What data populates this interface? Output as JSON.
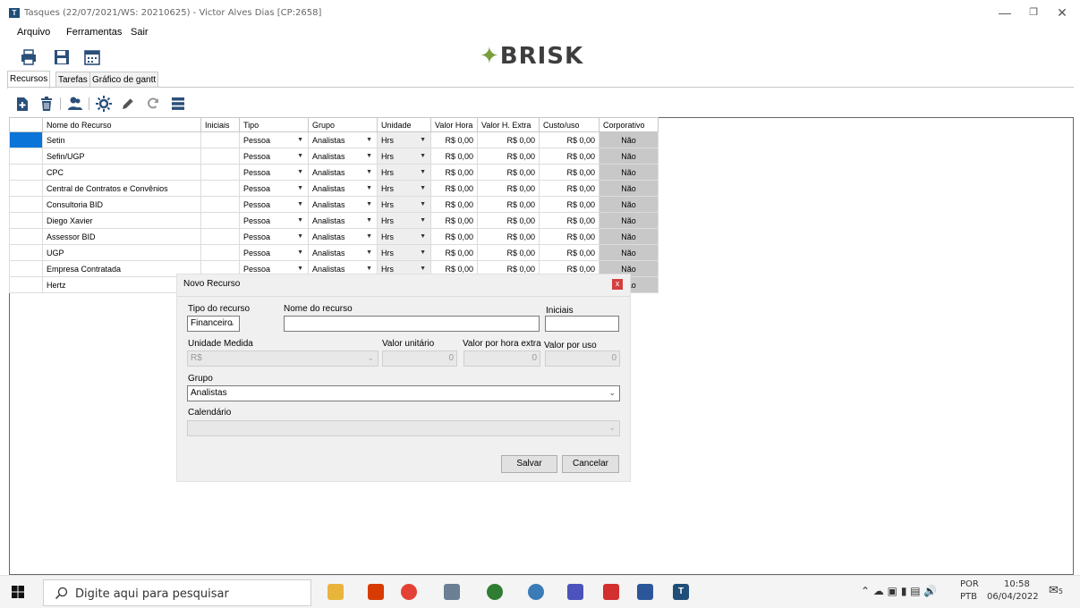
{
  "window": {
    "title": "Tasques (22/07/2021/WS: 20210625) - Victor Alves Dias [CP:2658]",
    "app_icon": "T"
  },
  "menu": [
    "Arquivo",
    "Ferramentas",
    "Sair"
  ],
  "logo": {
    "text": "BRISK",
    "mark": "✦"
  },
  "tabs": [
    {
      "label": "Recursos",
      "active": true
    },
    {
      "label": "Tarefas",
      "active": false
    },
    {
      "label": "Gráfico de gantt",
      "active": false
    }
  ],
  "grid": {
    "columns": [
      "Nome do Recurso",
      "Iniciais",
      "Tipo",
      "Grupo",
      "Unidade",
      "Valor Hora",
      "Valor H. Extra",
      "Custo/uso",
      "Corporativo"
    ],
    "rows": [
      {
        "nome": "Setin",
        "iniciais": "",
        "tipo": "Pessoa",
        "grupo": "Analistas",
        "unidade": "Hrs",
        "valor_hora": "R$ 0,00",
        "valor_extra": "R$ 0,00",
        "custo": "R$ 0,00",
        "corporativo": "Não"
      },
      {
        "nome": "Sefin/UGP",
        "iniciais": "",
        "tipo": "Pessoa",
        "grupo": "Analistas",
        "unidade": "Hrs",
        "valor_hora": "R$ 0,00",
        "valor_extra": "R$ 0,00",
        "custo": "R$ 0,00",
        "corporativo": "Não"
      },
      {
        "nome": "CPC",
        "iniciais": "",
        "tipo": "Pessoa",
        "grupo": "Analistas",
        "unidade": "Hrs",
        "valor_hora": "R$ 0,00",
        "valor_extra": "R$ 0,00",
        "custo": "R$ 0,00",
        "corporativo": "Não"
      },
      {
        "nome": "Central de Contratos e Convênios",
        "iniciais": "",
        "tipo": "Pessoa",
        "grupo": "Analistas",
        "unidade": "Hrs",
        "valor_hora": "R$ 0,00",
        "valor_extra": "R$ 0,00",
        "custo": "R$ 0,00",
        "corporativo": "Não"
      },
      {
        "nome": "Consultoria BID",
        "iniciais": "",
        "tipo": "Pessoa",
        "grupo": "Analistas",
        "unidade": "Hrs",
        "valor_hora": "R$ 0,00",
        "valor_extra": "R$ 0,00",
        "custo": "R$ 0,00",
        "corporativo": "Não"
      },
      {
        "nome": "Diego Xavier",
        "iniciais": "",
        "tipo": "Pessoa",
        "grupo": "Analistas",
        "unidade": "Hrs",
        "valor_hora": "R$ 0,00",
        "valor_extra": "R$ 0,00",
        "custo": "R$ 0,00",
        "corporativo": "Não"
      },
      {
        "nome": "Assessor BID",
        "iniciais": "",
        "tipo": "Pessoa",
        "grupo": "Analistas",
        "unidade": "Hrs",
        "valor_hora": "R$ 0,00",
        "valor_extra": "R$ 0,00",
        "custo": "R$ 0,00",
        "corporativo": "Não"
      },
      {
        "nome": "UGP",
        "iniciais": "",
        "tipo": "Pessoa",
        "grupo": "Analistas",
        "unidade": "Hrs",
        "valor_hora": "R$ 0,00",
        "valor_extra": "R$ 0,00",
        "custo": "R$ 0,00",
        "corporativo": "Não"
      },
      {
        "nome": "Empresa Contratada",
        "iniciais": "",
        "tipo": "Pessoa",
        "grupo": "Analistas",
        "unidade": "Hrs",
        "valor_hora": "R$ 0,00",
        "valor_extra": "R$ 0,00",
        "custo": "R$ 0,00",
        "corporativo": "Não"
      },
      {
        "nome": "Hertz",
        "iniciais": "",
        "tipo": "",
        "grupo": "",
        "unidade": "",
        "valor_hora": "",
        "valor_extra": "",
        "custo": "",
        "corporativo": "Não"
      }
    ]
  },
  "dialog": {
    "title": "Novo Recurso",
    "close_label": "x",
    "tipo_label": "Tipo do recurso",
    "tipo_value": "Financeiro",
    "nome_label": "Nome do recurso",
    "nome_value": "",
    "iniciais_label": "Iniciais",
    "iniciais_value": "",
    "unidade_label": "Unidade Medida",
    "unidade_value": "R$",
    "valor_unit_label": "Valor unitário",
    "valor_unit_value": "0",
    "valor_extra_label": "Valor por hora extra",
    "valor_extra_value": "0",
    "valor_uso_label": "Valor por uso",
    "valor_uso_value": "0",
    "grupo_label": "Grupo",
    "grupo_value": "Analistas",
    "calendario_label": "Calendário",
    "calendario_value": "",
    "save_label": "Salvar",
    "cancel_label": "Cancelar"
  },
  "taskbar": {
    "search_placeholder": "Digite aqui para pesquisar",
    "lang_top": "POR",
    "lang_bottom": "PTB",
    "time": "10:58",
    "date": "06/04/2022",
    "notif_count": "5"
  }
}
